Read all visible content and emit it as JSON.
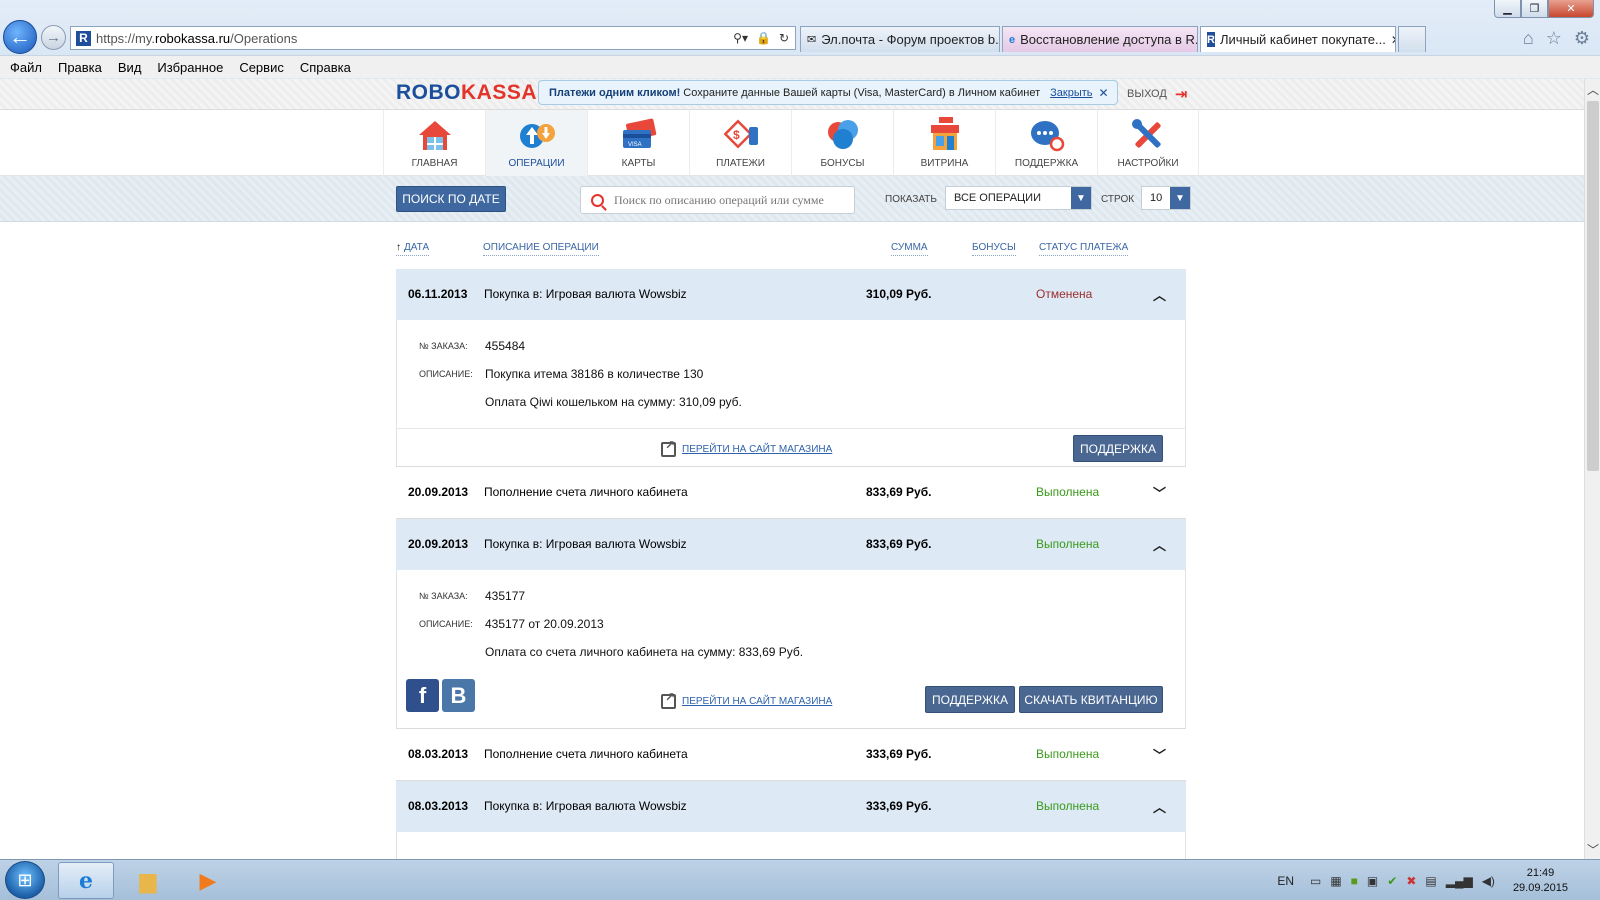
{
  "window": {
    "minimize": "▁",
    "maximize": "❐",
    "close": "✕"
  },
  "browser": {
    "url_prefix": "https://my.",
    "url_domain": "robokassa.ru",
    "url_path": "/Operations",
    "favicon": "R",
    "tabs": [
      {
        "title": "Эл.почта - Форум проектов b...",
        "icon": "mail-icon"
      },
      {
        "title": "Восстановление доступа в R...",
        "icon": "ie-icon"
      },
      {
        "title": "Личный кабинет покупате...",
        "icon": "robokassa-icon",
        "active": true
      }
    ],
    "menu": [
      "Файл",
      "Правка",
      "Вид",
      "Избранное",
      "Сервис",
      "Справка"
    ]
  },
  "header": {
    "logo_part1": "ROBO",
    "logo_part2": "KASSA",
    "promo_bold": "Платежи одним кликом!",
    "promo_text": "Сохраните данные Вашей карты (Visa, MasterCard) в Личном кабинет",
    "promo_close": "Закрыть",
    "logout": "ВЫХОД"
  },
  "nav": [
    {
      "label": "ГЛАВНАЯ",
      "icon": "home-icon"
    },
    {
      "label": "ОПЕРАЦИИ",
      "icon": "operations-icon",
      "active": true
    },
    {
      "label": "КАРТЫ",
      "icon": "cards-icon"
    },
    {
      "label": "ПЛАТЕЖИ",
      "icon": "payments-icon"
    },
    {
      "label": "БОНУСЫ",
      "icon": "bonuses-icon"
    },
    {
      "label": "ВИТРИНА",
      "icon": "shop-icon"
    },
    {
      "label": "ПОДДЕРЖКА",
      "icon": "support-icon"
    },
    {
      "label": "НАСТРОЙКИ",
      "icon": "settings-icon"
    }
  ],
  "filters": {
    "date_button": "ПОИСК ПО ДАТЕ",
    "search_placeholder": "Поиск по описанию операций или сумме",
    "show_label": "ПОКАЗАТЬ",
    "show_value": "ВСЕ ОПЕРАЦИИ",
    "rows_label": "СТРОК",
    "rows_value": "10"
  },
  "table": {
    "col_date": "ДАТА",
    "col_desc": "ОПИСАНИЕ ОПЕРАЦИИ",
    "col_sum": "СУММА",
    "col_bonus": "БОНУСЫ",
    "col_status": "СТАТУС ПЛАТЕЖА"
  },
  "labels": {
    "order_no": "№ ЗАКАЗА:",
    "description": "ОПИСАНИЕ:",
    "shop_link": "ПЕРЕЙТИ НА САЙТ МАГАЗИНА",
    "support": "ПОДДЕРЖКА",
    "receipt": "СКАЧАТЬ КВИТАНЦИЮ",
    "fb": "f",
    "vk": "B"
  },
  "operations": [
    {
      "date": "06.11.2013",
      "desc": "Покупка в: Игровая валюта Wowsbiz",
      "sum": "310,09 Руб.",
      "status": "Отменена",
      "order": "455484",
      "detail1": "Покупка итема 38186 в количестве 130",
      "detail2": "Оплата Qiwi кошельком на сумму: 310,09 руб."
    },
    {
      "date": "20.09.2013",
      "desc": "Пополнение счета личного кабинета",
      "sum": "833,69 Руб.",
      "status": "Выполнена"
    },
    {
      "date": "20.09.2013",
      "desc": "Покупка в: Игровая валюта Wowsbiz",
      "sum": "833,69 Руб.",
      "status": "Выполнена",
      "order": "435177",
      "detail1": "435177 от 20.09.2013",
      "detail2": "Оплата со счета личного кабинета на сумму: 833,69 Руб."
    },
    {
      "date": "08.03.2013",
      "desc": "Пополнение счета личного кабинета",
      "sum": "333,69 Руб.",
      "status": "Выполнена"
    },
    {
      "date": "08.03.2013",
      "desc": "Покупка в: Игровая валюта Wowsbiz",
      "sum": "333,69 Руб.",
      "status": "Выполнена"
    }
  ],
  "taskbar": {
    "lang": "EN",
    "time": "21:49",
    "date": "29.09.2015"
  },
  "colors": {
    "brand_blue": "#1b4f9c",
    "brand_red": "#e3342b",
    "ok_green": "#3a9a1a",
    "cancel_red": "#9b2d2d",
    "expanded_row": "#dde9f5"
  }
}
